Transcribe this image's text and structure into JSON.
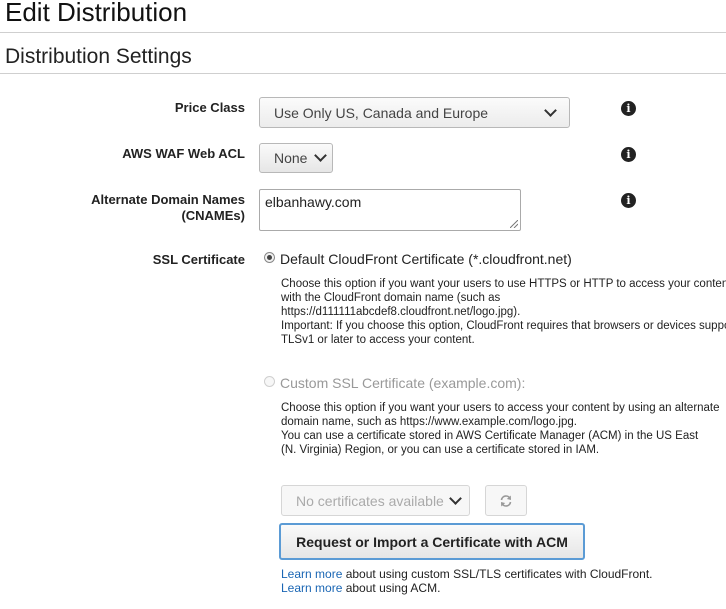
{
  "page": {
    "title": "Edit Distribution",
    "section_title": "Distribution Settings"
  },
  "price_class": {
    "label": "Price Class",
    "selected": "Use Only US, Canada and Europe"
  },
  "waf": {
    "label": "AWS WAF Web ACL",
    "selected": "None"
  },
  "cnames": {
    "label_line1": "Alternate Domain Names",
    "label_line2": "(CNAMEs)",
    "value": "elbanhawy.com"
  },
  "ssl": {
    "label": "SSL Certificate",
    "default_option": {
      "label": "Default CloudFront Certificate (*.cloudfront.net)",
      "selected": true,
      "description_lines": [
        "Choose this option if you want your users to use HTTPS or HTTP to access your content",
        "with the CloudFront domain name (such as",
        "https://d111111abcdef8.cloudfront.net/logo.jpg).",
        "Important: If you choose this option, CloudFront requires that browsers or devices support",
        "TLSv1 or later to access your content."
      ]
    },
    "custom_option": {
      "label": "Custom SSL Certificate (example.com):",
      "selected": false,
      "enabled": false,
      "description_lines": [
        "Choose this option if you want your users to access your content by using an alternate",
        "domain name, such as https://www.example.com/logo.jpg.",
        "You can use a certificate stored in AWS Certificate Manager (ACM) in the US East",
        "(N. Virginia) Region, or you can use a certificate stored in IAM."
      ]
    },
    "certificate_select": "No certificates available",
    "request_button": "Request or Import a Certificate with ACM",
    "learn_more_1": {
      "link": "Learn more",
      "text": " about using custom SSL/TLS certificates with CloudFront."
    },
    "learn_more_2": {
      "link": "Learn more",
      "text": " about using ACM."
    }
  },
  "icons": {
    "info": "info-circle-icon",
    "refresh": "refresh-icon",
    "chevron": "chevron-down-icon"
  },
  "colors": {
    "link": "#1a66b4",
    "focus_border": "#5b9bd5"
  }
}
